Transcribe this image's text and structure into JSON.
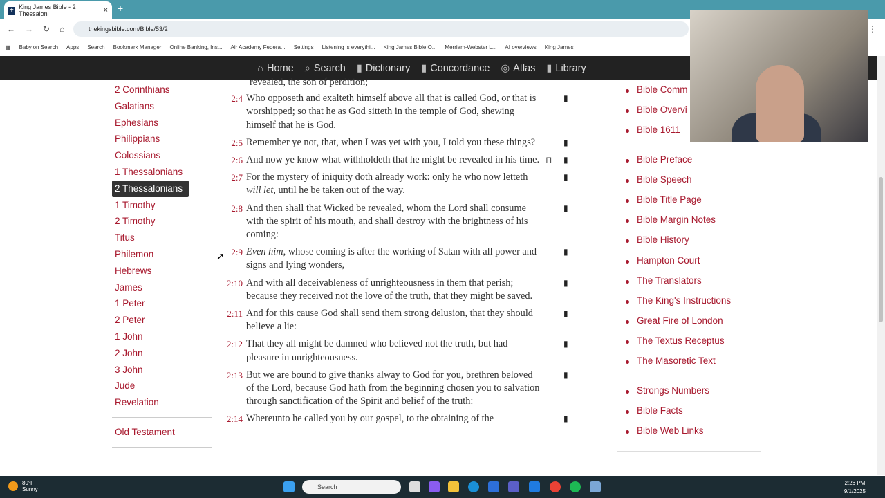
{
  "browser": {
    "tab_title": "King James Bible - 2 Thessaloni",
    "url": "thekingsbible.com/Bible/53/2",
    "bookmarks": [
      "Babylon Search",
      "Apps",
      "Search",
      "Bookmark Manager",
      "Online Banking, Ins...",
      "Air Academy Federa...",
      "Settings",
      "Listening is everythi...",
      "King James Bible O...",
      "Merriam-Webster L...",
      "AI overviews",
      "King James"
    ]
  },
  "nav": [
    {
      "icon": "home-icon",
      "label": "Home"
    },
    {
      "icon": "search-icon",
      "label": "Search"
    },
    {
      "icon": "book-icon",
      "label": "Dictionary"
    },
    {
      "icon": "book-icon",
      "label": "Concordance"
    },
    {
      "icon": "globe-icon",
      "label": "Atlas"
    },
    {
      "icon": "book-icon",
      "label": "Library"
    }
  ],
  "books": [
    "2 Corinthians",
    "Galatians",
    "Ephesians",
    "Philippians",
    "Colossians",
    "1 Thessalonians",
    "2 Thessalonians",
    "1 Timothy",
    "2 Timothy",
    "Titus",
    "Philemon",
    "Hebrews",
    "James",
    "1 Peter",
    "2 Peter",
    "1 John",
    "2 John",
    "3 John",
    "Jude",
    "Revelation"
  ],
  "active_book": "2 Thessalonians",
  "old_testament": "Old Testament",
  "verse_fragment": "revealed, the son of perdition;",
  "verses": [
    {
      "n": "2:4",
      "text": "Who opposeth and exalteth himself above all that is called God, or that is worshipped; so that he as God sitteth in the temple of God, shewing himself that he is God."
    },
    {
      "n": "2:5",
      "text": "Remember ye not, that, when I was yet with you, I told you these things?"
    },
    {
      "n": "2:6",
      "text": "And now ye know what withholdeth that he might be revealed in his time."
    },
    {
      "n": "2:7",
      "pre": "For the mystery of iniquity doth already work: only he who now letteth ",
      "ital": "will let",
      "post": ", until he be taken out of the way."
    },
    {
      "n": "2:8",
      "text": "And then shall that Wicked be revealed, whom the Lord shall consume with the spirit of his mouth, and shall destroy with the brightness of his coming:"
    },
    {
      "n": "2:9",
      "ital": "Even him",
      "post": ", whose coming is after the working of Satan with all power and signs and lying wonders,"
    },
    {
      "n": "2:10",
      "text": "And with all deceivableness of unrighteousness in them that perish; because they received not the love of the truth, that they might be saved."
    },
    {
      "n": "2:11",
      "text": "And for this cause God shall send them strong delusion, that they should believe a lie:"
    },
    {
      "n": "2:12",
      "text": "That they all might be damned who believed not the truth, but had pleasure in unrighteousness."
    },
    {
      "n": "2:13",
      "text": "But we are bound to give thanks alway to God for you, brethren beloved of the Lord, because God hath from the beginning chosen you to salvation through sanctification of the Spirit and belief of the truth:"
    },
    {
      "n": "2:14",
      "text": "Whereunto he called you by our gospel, to the obtaining of the"
    }
  ],
  "right_groups": [
    [
      "Bible Comm",
      "Bible Overvi",
      "Bible 1611"
    ],
    [
      "Bible Preface",
      "Bible Speech",
      "Bible Title Page",
      "Bible Margin Notes",
      "Bible History",
      "Hampton Court",
      "The Translators",
      "The King's Instructions",
      "Great Fire of London",
      "The Textus Receptus",
      "The Masoretic Text"
    ],
    [
      "Strongs Numbers",
      "Bible Facts",
      "Bible Web Links"
    ]
  ],
  "taskbar": {
    "temp": "80°F",
    "weather": "Sunny",
    "search": "Search",
    "time": "2:26 PM",
    "date": "9/1/2025"
  },
  "colors": {
    "link": "#a8192e",
    "nav_bg": "#222222"
  }
}
